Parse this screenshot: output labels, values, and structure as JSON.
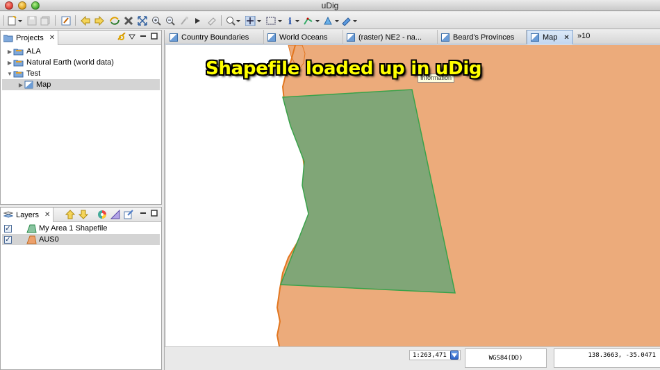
{
  "window": {
    "title": "uDig"
  },
  "projects": {
    "tab_label": "Projects",
    "items": [
      {
        "label": "ALA"
      },
      {
        "label": "Natural Earth (world data)"
      },
      {
        "label": "Test"
      },
      {
        "label": "Map"
      }
    ]
  },
  "layers": {
    "tab_label": "Layers",
    "items": [
      {
        "label": "My Area 1 Shapefile",
        "checked": true
      },
      {
        "label": "AUS0",
        "checked": true
      }
    ]
  },
  "editor": {
    "tabs": [
      {
        "label": "Country Boundaries"
      },
      {
        "label": "World Oceans"
      },
      {
        "label": "(raster) NE2 - na..."
      },
      {
        "label": "Beard's Provinces"
      },
      {
        "label": "Map"
      }
    ],
    "more_label": "»10"
  },
  "map": {
    "headline": "Shapefile loaded up in uDig",
    "tooltip": "Information",
    "land_color": "#ECAB7B",
    "coast_color": "#E2761F",
    "shape_fill": "#80A677",
    "shape_stroke": "#39A24A"
  },
  "status": {
    "scale": "1:263,471",
    "crs": "WGS84(DD)",
    "coords": "138.3663, -35.0471"
  }
}
